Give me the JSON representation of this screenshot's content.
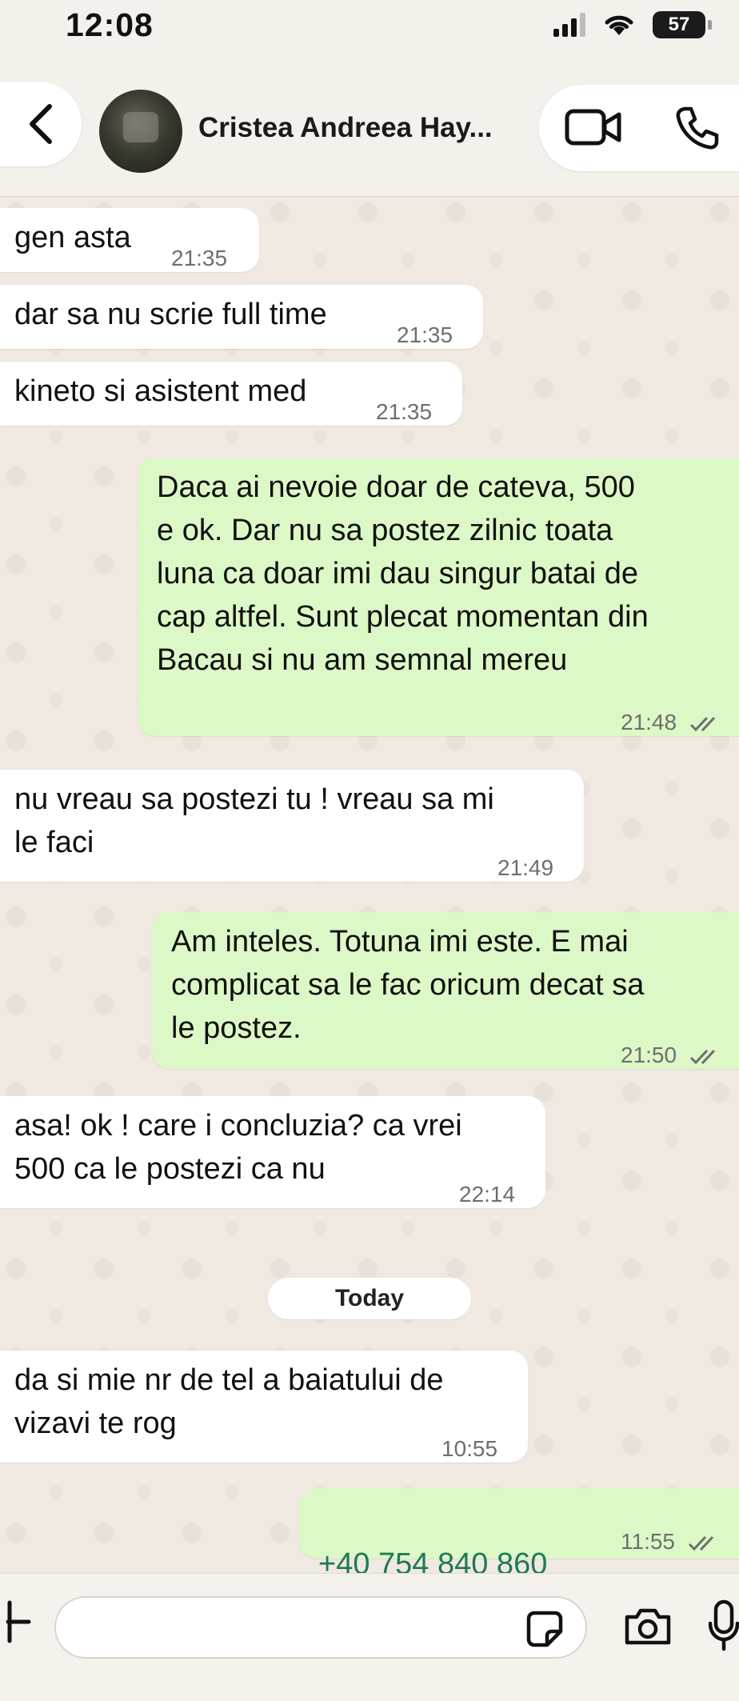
{
  "status_bar": {
    "time": "12:08",
    "battery": "57"
  },
  "header": {
    "contact_name": "Cristea Andreea Hay..."
  },
  "messages": [
    {
      "dir": "in",
      "text": "gen asta",
      "time": "21:35"
    },
    {
      "dir": "in",
      "text": "dar sa nu scrie full time",
      "time": "21:35"
    },
    {
      "dir": "in",
      "text": "kineto si asistent med",
      "time": "21:35"
    },
    {
      "dir": "out",
      "text": "Daca ai nevoie doar de cateva, 500\ne ok. Dar nu sa postez zilnic toata\nluna ca doar imi dau singur batai de\ncap altfel. Sunt plecat momentan din\nBacau si nu am semnal mereu",
      "time": "21:48"
    },
    {
      "dir": "in",
      "text": "nu vreau sa postezi tu ! vreau sa mi\nle faci",
      "time": "21:49"
    },
    {
      "dir": "out",
      "text": "Am inteles. Totuna imi este. E mai\ncomplicat sa le fac oricum decat sa\nle postez.",
      "time": "21:50"
    },
    {
      "dir": "in",
      "text": "asa! ok ! care i concluzia? ca vrei\n500 ca le postezi ca nu",
      "time": "22:14"
    },
    {
      "dir": "in",
      "text": "da si mie nr de tel a baiatului de\nvizavi te rog",
      "time": "10:55"
    },
    {
      "dir": "out",
      "text": "+40 754 840 860",
      "time": "11:55"
    }
  ],
  "date_separator": "Today",
  "composer": {
    "placeholder": ""
  },
  "colors": {
    "incoming": "#ffffff",
    "outgoing": "#dcf8c6",
    "background": "#efe9e1",
    "link": "#1f7a54"
  }
}
